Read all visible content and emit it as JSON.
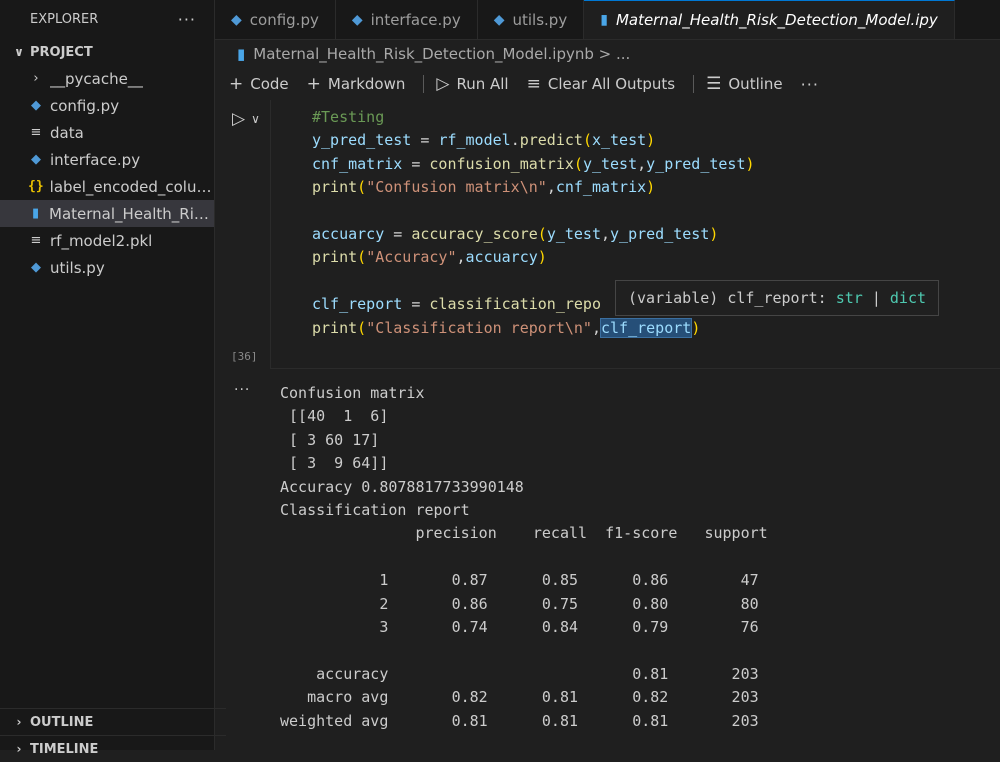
{
  "sidebar": {
    "title": "EXPLORER",
    "more": "···",
    "project_label": "PROJECT",
    "items": [
      {
        "label": "__pycache__"
      },
      {
        "label": "config.py"
      },
      {
        "label": "data"
      },
      {
        "label": "interface.py"
      },
      {
        "label": "label_encoded_colum..."
      },
      {
        "label": "Maternal_Health_Risk..."
      },
      {
        "label": "rf_model2.pkl"
      },
      {
        "label": "utils.py"
      }
    ],
    "outline_label": "OUTLINE",
    "timeline_label": "TIMELINE"
  },
  "tabs": [
    {
      "label": "config.py"
    },
    {
      "label": "interface.py"
    },
    {
      "label": "utils.py"
    },
    {
      "label": "Maternal_Health_Risk_Detection_Model.ipy"
    }
  ],
  "breadcrumb": {
    "text": "Maternal_Health_Risk_Detection_Model.ipynb > ..."
  },
  "toolbar": {
    "code": "Code",
    "markdown": "Markdown",
    "run_all": "Run All",
    "clear_outputs": "Clear All Outputs",
    "outline": "Outline",
    "more": "···"
  },
  "cell": {
    "execution_count": "[36]",
    "code_lines": [
      [
        [
          "#Testing",
          "c-comment"
        ]
      ],
      [
        [
          "y_pred_test",
          "c-var"
        ],
        [
          " = ",
          "c-op"
        ],
        [
          "rf_model",
          "c-var"
        ],
        [
          ".",
          "c-op"
        ],
        [
          "predict",
          "c-fn"
        ],
        [
          "(",
          "c-paren"
        ],
        [
          "x_test",
          "c-var"
        ],
        [
          ")",
          "c-paren"
        ]
      ],
      [
        [
          "cnf_matrix",
          "c-var"
        ],
        [
          " = ",
          "c-op"
        ],
        [
          "confusion_matrix",
          "c-fn"
        ],
        [
          "(",
          "c-paren"
        ],
        [
          "y_test",
          "c-var"
        ],
        [
          ",",
          "c-op"
        ],
        [
          "y_pred_test",
          "c-var"
        ],
        [
          ")",
          "c-paren"
        ]
      ],
      [
        [
          "print",
          "c-fn"
        ],
        [
          "(",
          "c-paren"
        ],
        [
          "\"Confusion matrix\\n\"",
          "c-str"
        ],
        [
          ",",
          "c-op"
        ],
        [
          "cnf_matrix",
          "c-var"
        ],
        [
          ")",
          "c-paren"
        ]
      ],
      [],
      [
        [
          "accuarcy",
          "c-var"
        ],
        [
          " = ",
          "c-op"
        ],
        [
          "accuracy_score",
          "c-fn"
        ],
        [
          "(",
          "c-paren"
        ],
        [
          "y_test",
          "c-var"
        ],
        [
          ",",
          "c-op"
        ],
        [
          "y_pred_test",
          "c-var"
        ],
        [
          ")",
          "c-paren"
        ]
      ],
      [
        [
          "print",
          "c-fn"
        ],
        [
          "(",
          "c-paren"
        ],
        [
          "\"Accuracy\"",
          "c-str"
        ],
        [
          ",",
          "c-op"
        ],
        [
          "accuarcy",
          "c-var"
        ],
        [
          ")",
          "c-paren"
        ]
      ],
      [],
      [
        [
          "clf_report",
          "c-var"
        ],
        [
          " = ",
          "c-op"
        ],
        [
          "classification_repo",
          "c-fn"
        ]
      ],
      [
        [
          "print",
          "c-fn"
        ],
        [
          "(",
          "c-paren"
        ],
        [
          "\"Classification report\\n\"",
          "c-str"
        ],
        [
          ",",
          "c-op"
        ],
        [
          "clf_report",
          "c-var hl"
        ],
        [
          ")",
          "c-paren"
        ]
      ]
    ],
    "hover": {
      "prefix": "(variable) clf_report: ",
      "type1": "str",
      "sep": " | ",
      "type2": "dict"
    }
  },
  "output": {
    "dots": "···",
    "text": "Confusion matrix\n [[40  1  6]\n [ 3 60 17]\n [ 3  9 64]]\nAccuracy 0.8078817733990148\nClassification report\n               precision    recall  f1-score   support\n\n           1       0.87      0.85      0.86        47\n           2       0.86      0.75      0.80        80\n           3       0.74      0.84      0.79        76\n\n    accuracy                           0.81       203\n   macro avg       0.82      0.81      0.82       203\nweighted avg       0.81      0.81      0.81       203"
  }
}
